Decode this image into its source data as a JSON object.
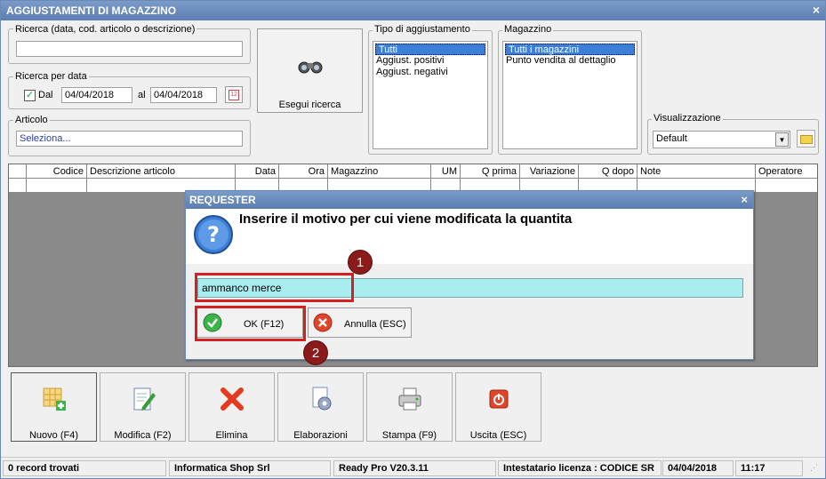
{
  "window": {
    "title": "AGGIUSTAMENTI DI MAGAZZINO",
    "close": "×"
  },
  "search": {
    "label": "Ricerca (data, cod. articolo o descrizione)",
    "value": "",
    "date_group_label": "Ricerca per data",
    "dal_label": "Dal",
    "dal_checked": true,
    "date_from": "04/04/2018",
    "al_label": "al",
    "date_to": "04/04/2018",
    "article_label": "Articolo",
    "article_value": "Seleziona...",
    "run_button": "Esegui ricerca"
  },
  "adjustment_type": {
    "label": "Tipo di aggiustamento",
    "items": [
      "Tutti",
      "Aggiust. positivi",
      "Aggiust. negativi"
    ],
    "selected": "Tutti"
  },
  "warehouse": {
    "label": "Magazzino",
    "items": [
      "Tutti i magazzini",
      "Punto vendita al dettaglio"
    ],
    "selected": "Tutti i magazzini"
  },
  "view": {
    "label": "Visualizzazione",
    "value": "Default"
  },
  "table": {
    "columns": [
      "Codice",
      "Descrizione articolo",
      "Data",
      "Ora",
      "Magazzino",
      "UM",
      "Q prima",
      "Variazione",
      "Q dopo",
      "Note",
      "Operatore"
    ]
  },
  "toolbar": {
    "new": "Nuovo (F4)",
    "edit": "Modifica (F2)",
    "delete": "Elimina",
    "process": "Elaborazioni",
    "print": "Stampa (F9)",
    "exit": "Uscita (ESC)"
  },
  "status": {
    "records": "0 record trovati",
    "company": "Informatica Shop Srl",
    "version": "Ready Pro V20.3.11",
    "license": "Intestatario licenza : CODICE SR",
    "date": "04/04/2018",
    "time": "11:17"
  },
  "dialog": {
    "title": "REQUESTER",
    "close": "×",
    "message": "Inserire il motivo per cui viene modificata la quantita",
    "input_value": "ammanco merce",
    "ok": "OK (F12)",
    "cancel": "Annulla (ESC)"
  },
  "annotations": {
    "step1": "1",
    "step2": "2"
  },
  "colors": {
    "titlebar": "#5b7db0",
    "selection": "#3d7fd6",
    "input_highlight": "#a8eef0",
    "annotation": "#d42020",
    "badge": "#8b1a1a"
  }
}
